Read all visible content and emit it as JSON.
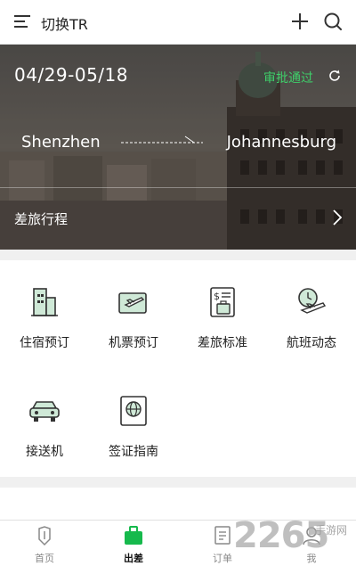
{
  "header": {
    "title": "切换TR",
    "icons": [
      "menu-icon",
      "plus-icon",
      "search-icon"
    ]
  },
  "trip": {
    "dates": "04/29-05/18",
    "status": "审批通过",
    "status_color": "#3fcf6a",
    "from": "Shenzhen",
    "to": "Johannesburg",
    "itinerary_label": "差旅行程"
  },
  "services": [
    {
      "label": "住宿预订",
      "icon": "hotel-building-icon"
    },
    {
      "label": "机票预订",
      "icon": "flight-ticket-icon"
    },
    {
      "label": "差旅标准",
      "icon": "travel-policy-icon"
    },
    {
      "label": "航班动态",
      "icon": "flight-status-icon"
    },
    {
      "label": "接送机",
      "icon": "car-icon"
    },
    {
      "label": "签证指南",
      "icon": "passport-globe-icon"
    }
  ],
  "tabs": [
    {
      "label": "首页",
      "icon": "shield-home-icon",
      "active": false
    },
    {
      "label": "出差",
      "icon": "briefcase-icon",
      "active": true
    },
    {
      "label": "订单",
      "icon": "order-list-icon",
      "active": false
    },
    {
      "label": "我",
      "icon": "person-icon",
      "active": false
    }
  ],
  "watermark": {
    "number": "2265",
    "text": "手游网"
  },
  "colors": {
    "accent": "#16b94c",
    "icon_fill": "#cfe9d7",
    "icon_stroke": "#333333"
  }
}
